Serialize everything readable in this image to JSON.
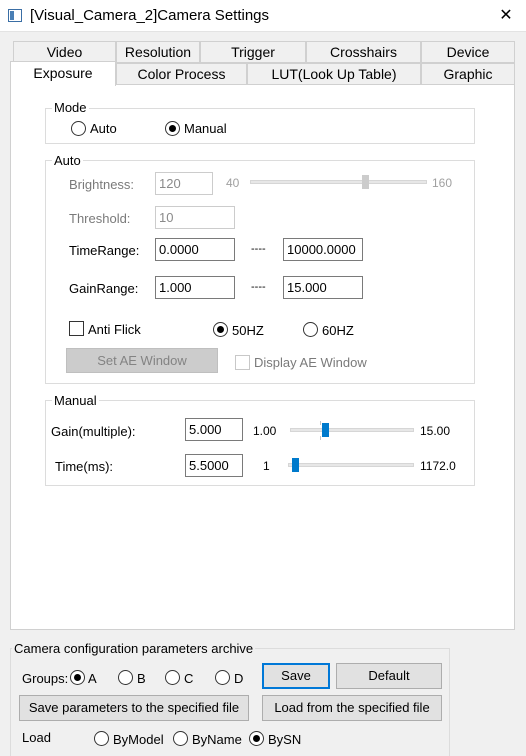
{
  "window": {
    "title": "[Visual_Camera_2]Camera Settings",
    "close_glyph": "✕"
  },
  "tabs": {
    "row1": [
      "Video",
      "Resolution",
      "Trigger",
      "Crosshairs",
      "Device"
    ],
    "row2": [
      "Exposure",
      "Color Process",
      "LUT(Look Up Table)",
      "Graphic"
    ],
    "active": "Exposure"
  },
  "mode": {
    "title": "Mode",
    "options": [
      "Auto",
      "Manual"
    ],
    "selected": "Manual"
  },
  "auto": {
    "title": "Auto",
    "brightness_label": "Brightness:",
    "brightness_value": "120",
    "brightness_min": "40",
    "brightness_max": "160",
    "threshold_label": "Threshold:",
    "threshold_value": "10",
    "timerange_label": "TimeRange:",
    "timerange_from": "0.0000",
    "timerange_sep": "----",
    "timerange_to": "10000.0000",
    "gainrange_label": "GainRange:",
    "gainrange_from": "1.000",
    "gainrange_sep": "----",
    "gainrange_to": "15.000",
    "anti_flick_label": "Anti Flick",
    "anti_flick_checked": false,
    "hz_options": [
      "50HZ",
      "60HZ"
    ],
    "hz_selected": "50HZ",
    "set_ae_window_label": "Set AE Window",
    "display_ae_window_label": "Display AE Window",
    "display_ae_window_checked": false
  },
  "manual": {
    "title": "Manual",
    "gain_label": "Gain(multiple):",
    "gain_value": "5.000",
    "gain_min": "1.00",
    "gain_max": "15.00",
    "time_label": "Time(ms):",
    "time_value": "5.5000",
    "time_min": "1",
    "time_max": "1172.0"
  },
  "archive": {
    "title": "Camera configuration parameters archive",
    "groups_label": "Groups:",
    "groups": [
      "A",
      "B",
      "C",
      "D"
    ],
    "group_selected": "A",
    "save_label": "Save",
    "default_label": "Default",
    "save_file_label": "Save parameters to the specified file",
    "load_file_label": "Load from the specified file",
    "load_label": "Load",
    "load_options": [
      "ByModel",
      "ByName",
      "BySN"
    ],
    "load_selected": "BySN"
  },
  "colors": {
    "accent": "#0078d7",
    "slider_thumb": "#007acc",
    "disabled_text": "#838383"
  }
}
